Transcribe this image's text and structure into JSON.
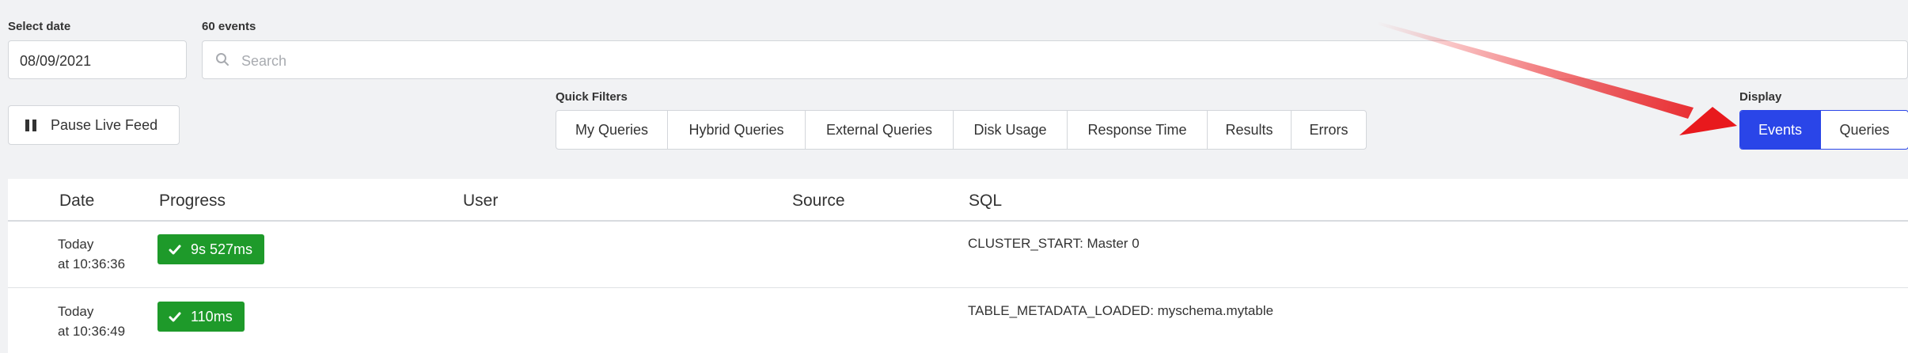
{
  "filters": {
    "date_label": "Select date",
    "date_value": "08/09/2021",
    "events_count": "60 events",
    "search_placeholder": "Search"
  },
  "controls": {
    "pause_label": "Pause Live Feed",
    "quick_filters_label": "Quick Filters",
    "quick_filters": [
      "My Queries",
      "Hybrid Queries",
      "External Queries",
      "Disk Usage",
      "Response Time",
      "Results",
      "Errors"
    ],
    "display_label": "Display",
    "display_options": [
      "Events",
      "Queries"
    ],
    "display_selected": "Events"
  },
  "colors": {
    "accent": "#2a45e8",
    "success": "#1e9a2a",
    "annotation_arrow": "#e8191d"
  },
  "table": {
    "headers": [
      "Date",
      "Progress",
      "User",
      "Source",
      "SQL"
    ],
    "rows": [
      {
        "date_line1": "Today",
        "date_line2": "at 10:36:36",
        "progress": "9s 527ms",
        "user": "",
        "source": "",
        "sql": "CLUSTER_START: Master 0"
      },
      {
        "date_line1": "Today",
        "date_line2": "at 10:36:49",
        "progress": "110ms",
        "user": "",
        "source": "",
        "sql": "TABLE_METADATA_LOADED: myschema.mytable"
      }
    ]
  }
}
